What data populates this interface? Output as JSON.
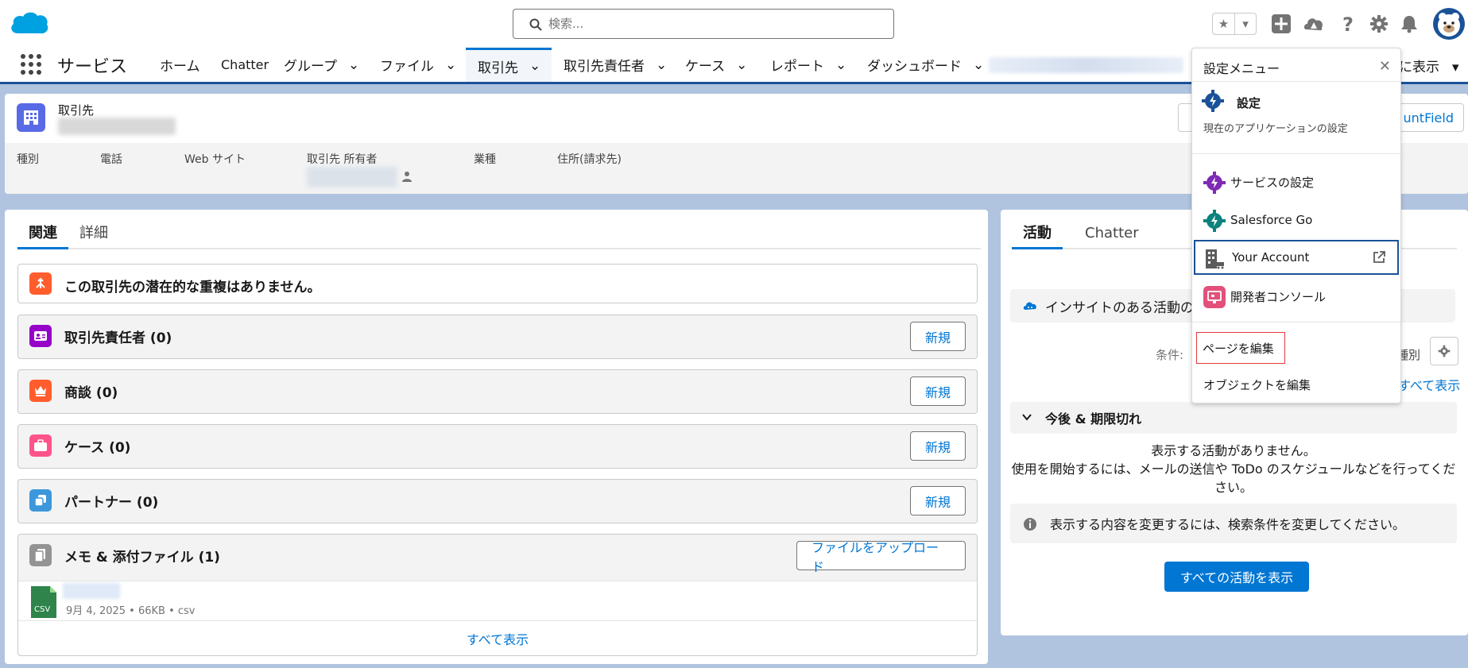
{
  "header": {
    "search_placeholder": "検索...",
    "icons": [
      "salesforce-cloud-logo",
      "search-icon",
      "star-icon",
      "chevron-down-icon",
      "plus-icon",
      "trailhead-icon",
      "help-icon",
      "gear-icon",
      "bell-icon",
      "avatar"
    ]
  },
  "nav": {
    "app_name": "サービス",
    "items": [
      {
        "label": "ホーム"
      },
      {
        "label": "Chatter"
      },
      {
        "label": "グループ"
      },
      {
        "label": "ファイル"
      },
      {
        "label": "取引先"
      },
      {
        "label": "取引先責任者"
      },
      {
        "label": "ケース"
      },
      {
        "label": "レポート"
      },
      {
        "label": "ダッシュボード"
      }
    ],
    "tail_label": "に表示"
  },
  "record": {
    "object_label": "取引先",
    "fields": [
      {
        "label": "種別"
      },
      {
        "label": "電話"
      },
      {
        "label": "Web サイト"
      },
      {
        "label": "取引先 所有者"
      },
      {
        "label": "業種"
      },
      {
        "label": "住所(請求先)"
      }
    ],
    "header_button": "untField"
  },
  "left": {
    "tabs": [
      "関連",
      "詳細"
    ],
    "duplicate_notice": "この取引先の潜在的な重複はありません。",
    "cards": [
      {
        "title": "取引先責任者 (0)",
        "button": "新規",
        "color": "#9602c7"
      },
      {
        "title": "商談 (0)",
        "button": "新規",
        "color": "#ff5d2d"
      },
      {
        "title": "ケース (0)",
        "button": "新規",
        "color": "#ff538a"
      },
      {
        "title": "パートナー (0)",
        "button": "新規",
        "color": "#3c97db"
      }
    ],
    "files_card": {
      "title": "メモ & 添付ファイル (1)",
      "button": "ファイルをアップロード",
      "file_type_label": "CSV",
      "file_meta": "9月 4, 2025 • 66KB • csv",
      "view_all": "すべて表示"
    }
  },
  "right": {
    "tabs": [
      "活動",
      "Chatter"
    ],
    "insight_text": "インサイトのある活動のみ",
    "filter_prefix": "条件: ",
    "sort_suffix": "種別",
    "show_all_link": "すべて表示",
    "section_title": "今後 & 期限切れ",
    "empty_line1": "表示する活動がありません。",
    "empty_line2": "使用を開始するには、メールの送信や ToDo のスケジュールなどを行ってください。",
    "notice": "表示する内容を変更するには、検索条件を変更してください。",
    "primary_button": "すべての活動を表示"
  },
  "settings_menu": {
    "title": "設定メニュー",
    "setup_label": "設定",
    "setup_desc": "現在のアプリケーションの設定",
    "items": [
      {
        "label": "サービスの設定",
        "color": "#7f2ab5"
      },
      {
        "label": "Salesforce Go",
        "color": "#0b827c"
      },
      {
        "label": "Your Account",
        "color": "#5c5c5c"
      },
      {
        "label": "開発者コンソール",
        "color": "#e3507a"
      }
    ],
    "edit_page": "ページを編集",
    "edit_object": "オブジェクトを編集"
  },
  "colors": {
    "brand": "#0176d3",
    "nav_bar": "#1b5297",
    "background": "#b0c4df"
  }
}
